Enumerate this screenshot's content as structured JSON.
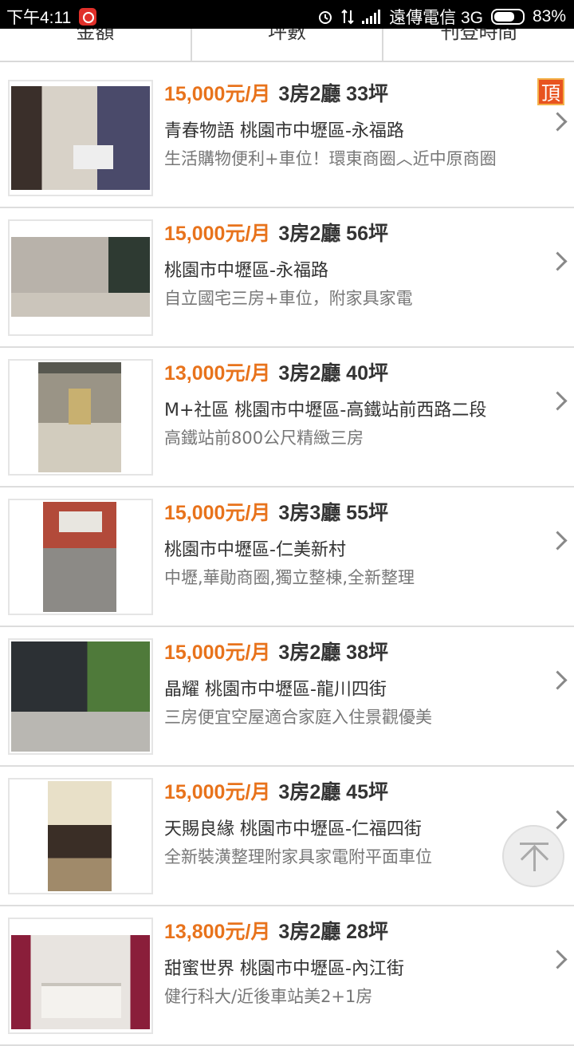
{
  "status_bar": {
    "time": "下午4:11",
    "carrier": "遠傳電信 3G",
    "battery": "83%",
    "battery_level": 0.83
  },
  "sort_tabs": [
    "金額",
    "坪數",
    "刊登時間"
  ],
  "listings": [
    {
      "price": "15,000元/月",
      "layout": "3房2廳 33坪",
      "address": "青春物語 桃園市中壢區-永福路",
      "description": "生活購物便利+車位！環東商圈︿近中原商圈",
      "badge": "頂"
    },
    {
      "price": "15,000元/月",
      "layout": "3房2廳 56坪",
      "address": "桃園市中壢區-永福路",
      "description": "自立國宅三房+車位，附家具家電"
    },
    {
      "price": "13,000元/月",
      "layout": "3房2廳 40坪",
      "address": "M+社區 桃園市中壢區-高鐵站前西路二段",
      "description": "高鐵站前800公尺精緻三房"
    },
    {
      "price": "15,000元/月",
      "layout": "3房3廳 55坪",
      "address": "桃園市中壢區-仁美新村",
      "description": "中壢,華勛商圈,獨立整棟,全新整理"
    },
    {
      "price": "15,000元/月",
      "layout": "3房2廳 38坪",
      "address": "晶耀 桃園市中壢區-龍川四街",
      "description": "三房便宜空屋適合家庭入住景觀優美"
    },
    {
      "price": "15,000元/月",
      "layout": "3房2廳 45坪",
      "address": "天賜良緣 桃園市中壢區-仁福四街",
      "description": "全新裝潢整理附家具家電附平面車位"
    },
    {
      "price": "13,800元/月",
      "layout": "3房2廳 28坪",
      "address": "甜蜜世界 桃園市中壢區-內江街",
      "description": "健行科大/近後車站美2+1房"
    }
  ],
  "colors": {
    "price": "#e8731c",
    "badge": "#e8531f"
  }
}
